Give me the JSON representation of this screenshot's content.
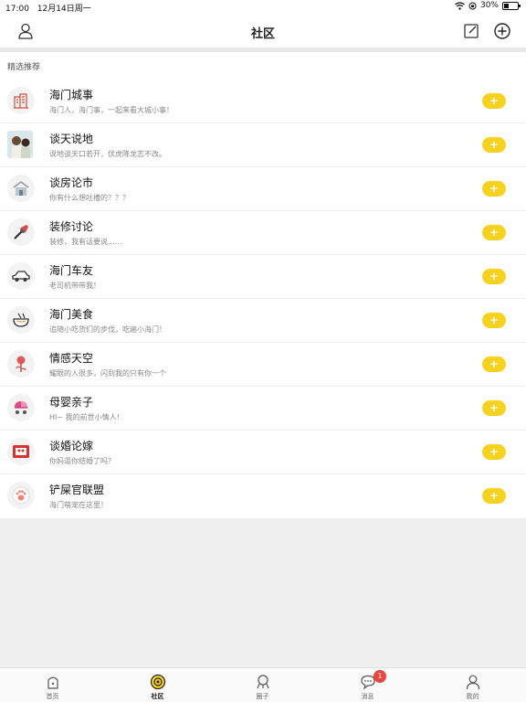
{
  "status_bar": {
    "time": "17:00",
    "date": "12月14日周一",
    "battery": "30%"
  },
  "header": {
    "title": "社区"
  },
  "section": {
    "label": "精选推荐"
  },
  "communities": [
    {
      "name": "海门城事",
      "desc": "海门人，海门事，一起来看大城小事！",
      "icon": "city-building-icon"
    },
    {
      "name": "谈天说地",
      "desc": "说地谈天口若开，伏虎降龙志不改。",
      "icon": "people-photo-icon"
    },
    {
      "name": "谈房论市",
      "desc": "你有什么想吐槽的？？？",
      "icon": "house-icon"
    },
    {
      "name": "装修讨论",
      "desc": "装修，我有话要说......",
      "icon": "paint-brush-icon"
    },
    {
      "name": "海门车友",
      "desc": "老司机带带我！",
      "icon": "car-icon"
    },
    {
      "name": "海门美食",
      "desc": "追随小吃货们的步伐，吃遍小海门！",
      "icon": "food-bowl-icon"
    },
    {
      "name": "情感天空",
      "desc": "耀眼的人很多，闪到我的只有你一个",
      "icon": "rose-icon"
    },
    {
      "name": "母婴亲子",
      "desc": "HI~ 我的前世小情人！",
      "icon": "stroller-icon"
    },
    {
      "name": "谈婚论嫁",
      "desc": "你妈逼你结婚了吗？",
      "icon": "wedding-certificate-icon"
    },
    {
      "name": "铲屎官联盟",
      "desc": "海门萌宠在这里！",
      "icon": "paw-icon"
    }
  ],
  "tabbar": {
    "tabs": [
      {
        "label": "首页",
        "icon": "home-icon"
      },
      {
        "label": "社区",
        "icon": "community-icon"
      },
      {
        "label": "圈子",
        "icon": "circle-icon"
      },
      {
        "label": "消息",
        "icon": "message-icon",
        "badge": "1"
      },
      {
        "label": "我的",
        "icon": "profile-icon"
      }
    ],
    "active_index": 1
  },
  "colors": {
    "accent": "#f7d21f",
    "badge": "#f04438",
    "background": "#efefef"
  }
}
